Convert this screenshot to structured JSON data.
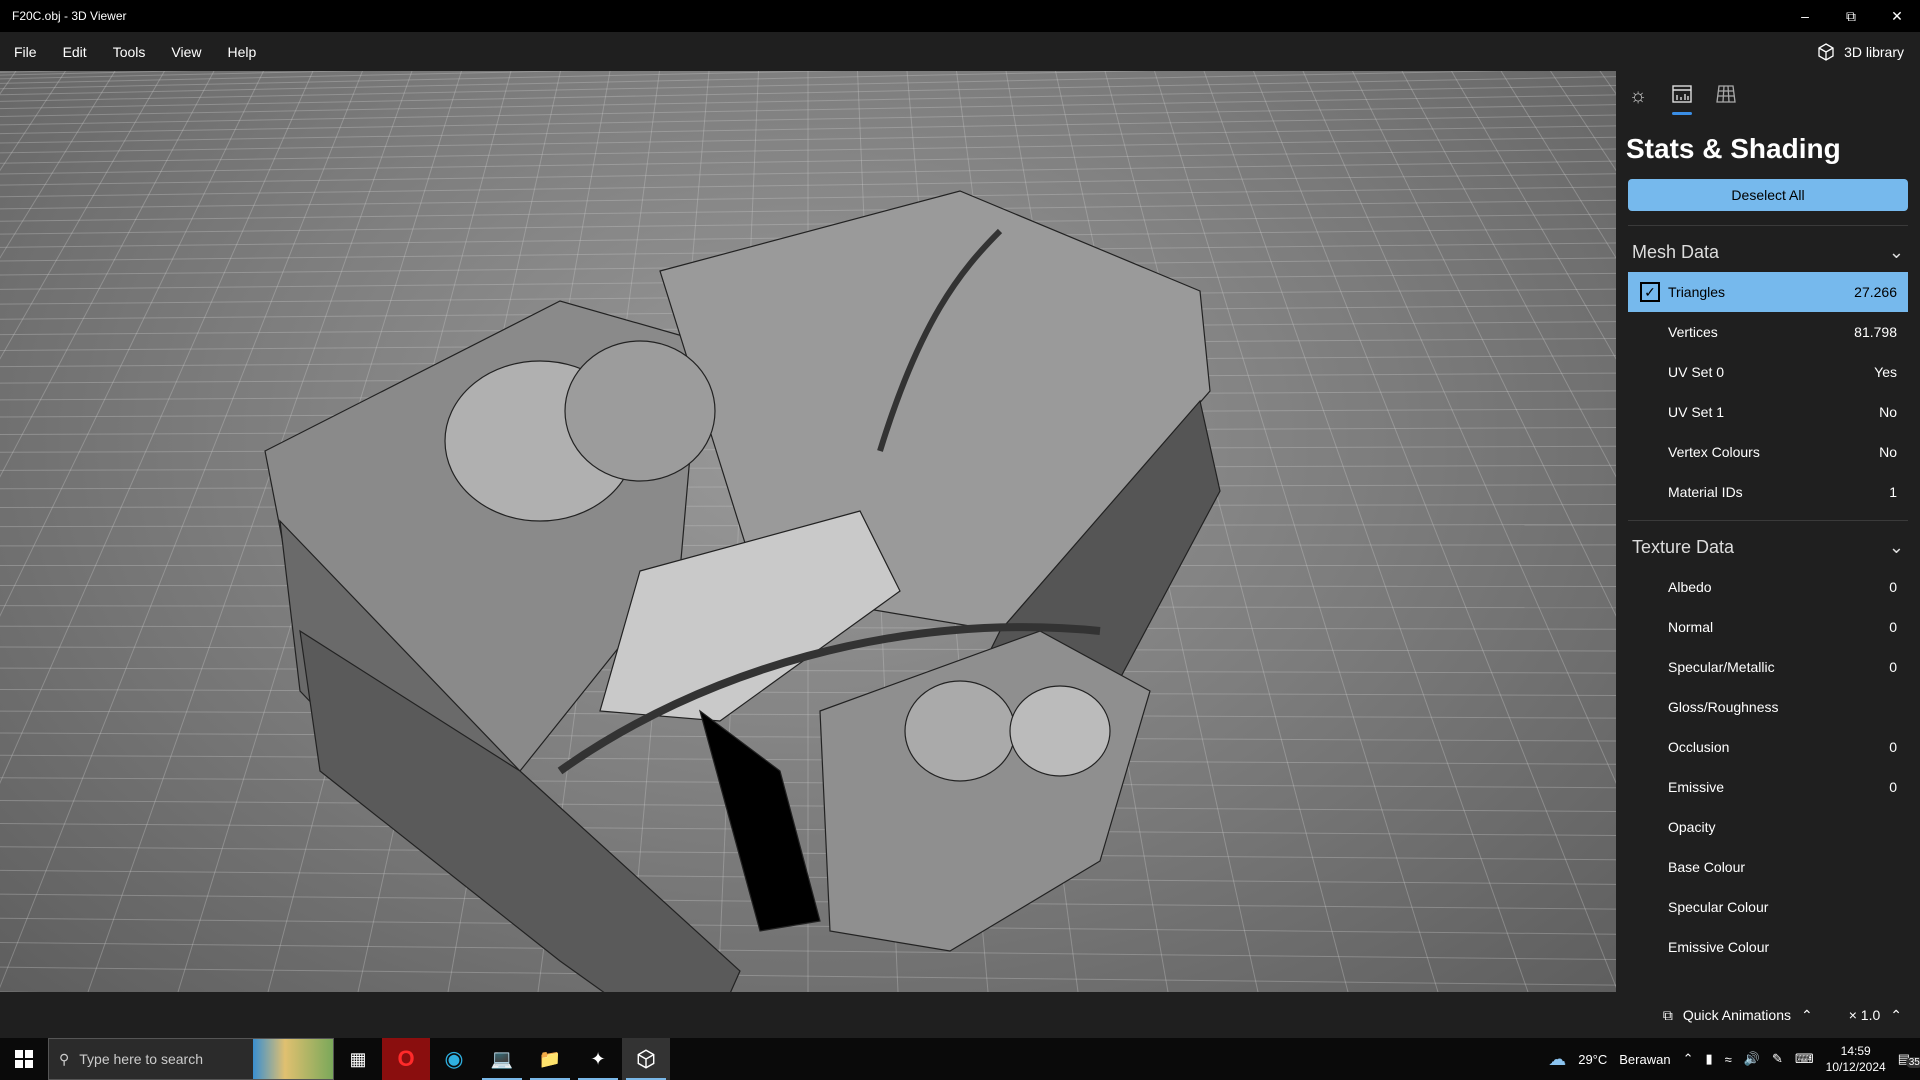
{
  "window": {
    "title": "F20C.obj - 3D Viewer"
  },
  "menu": [
    "File",
    "Edit",
    "Tools",
    "View",
    "Help"
  ],
  "library_label": "3D library",
  "panel": {
    "title": "Stats & Shading",
    "deselect_label": "Deselect All",
    "mesh": {
      "header": "Mesh Data",
      "rows": [
        {
          "label": "Triangles",
          "value": "27.266",
          "checked": true
        },
        {
          "label": "Vertices",
          "value": "81.798"
        },
        {
          "label": "UV Set 0",
          "value": "Yes"
        },
        {
          "label": "UV Set 1",
          "value": "No"
        },
        {
          "label": "Vertex Colours",
          "value": "No"
        },
        {
          "label": "Material IDs",
          "value": "1"
        }
      ]
    },
    "texture": {
      "header": "Texture Data",
      "rows": [
        {
          "label": "Albedo",
          "value": "0"
        },
        {
          "label": "Normal",
          "value": "0"
        },
        {
          "label": "Specular/Metallic",
          "value": "0"
        },
        {
          "label": "Gloss/Roughness",
          "value": ""
        },
        {
          "label": "Occlusion",
          "value": "0"
        },
        {
          "label": "Emissive",
          "value": "0"
        },
        {
          "label": "Opacity",
          "value": ""
        },
        {
          "label": "Base Colour",
          "value": ""
        },
        {
          "label": "Specular Colour",
          "value": ""
        },
        {
          "label": "Emissive Colour",
          "value": ""
        }
      ]
    }
  },
  "bottom": {
    "quick_animations": "Quick Animations",
    "speed": "× 1.0"
  },
  "taskbar": {
    "search_placeholder": "Type here to search",
    "weather_temp": "29°C",
    "weather_desc": "Berawan",
    "time": "14:59",
    "date": "10/12/2024",
    "notifications": "35"
  },
  "colors": {
    "accent": "#76b9ed",
    "tab_indicator": "#3a8ee6"
  }
}
